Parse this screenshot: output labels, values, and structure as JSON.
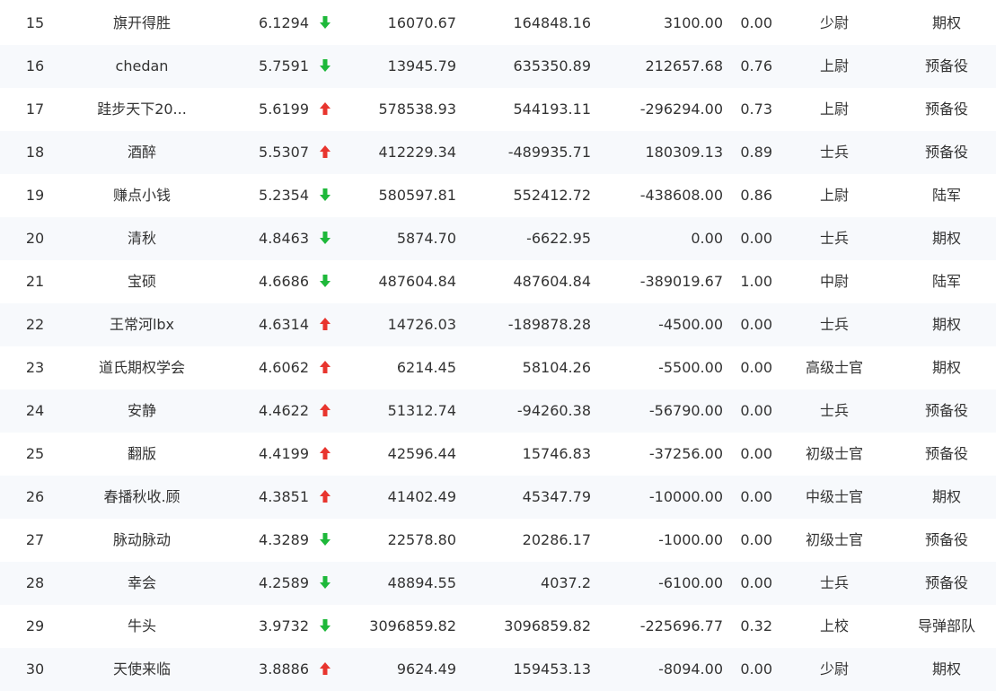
{
  "colors": {
    "up": "#e8352e",
    "down": "#1eb83a",
    "text": "#333333"
  },
  "icons": {
    "up": "arrow-up-icon",
    "down": "arrow-down-icon"
  },
  "rows": [
    {
      "rank": "15",
      "name": "旗开得胜",
      "score": "6.1294",
      "trend": "down",
      "v1": "16070.67",
      "v2": "164848.16",
      "v3": "3100.00",
      "ratio": "0.00",
      "level": "少尉",
      "group": "期权"
    },
    {
      "rank": "16",
      "name": "chedan",
      "score": "5.7591",
      "trend": "down",
      "v1": "13945.79",
      "v2": "635350.89",
      "v3": "212657.68",
      "ratio": "0.76",
      "level": "上尉",
      "group": "预备役"
    },
    {
      "rank": "17",
      "name": "跬步天下20...",
      "score": "5.6199",
      "trend": "up",
      "v1": "578538.93",
      "v2": "544193.11",
      "v3": "-296294.00",
      "ratio": "0.73",
      "level": "上尉",
      "group": "预备役"
    },
    {
      "rank": "18",
      "name": "酒醉",
      "score": "5.5307",
      "trend": "up",
      "v1": "412229.34",
      "v2": "-489935.71",
      "v3": "180309.13",
      "ratio": "0.89",
      "level": "士兵",
      "group": "预备役"
    },
    {
      "rank": "19",
      "name": "赚点小钱",
      "score": "5.2354",
      "trend": "down",
      "v1": "580597.81",
      "v2": "552412.72",
      "v3": "-438608.00",
      "ratio": "0.86",
      "level": "上尉",
      "group": "陆军"
    },
    {
      "rank": "20",
      "name": "清秋",
      "score": "4.8463",
      "trend": "down",
      "v1": "5874.70",
      "v2": "-6622.95",
      "v3": "0.00",
      "ratio": "0.00",
      "level": "士兵",
      "group": "期权"
    },
    {
      "rank": "21",
      "name": "宝硕",
      "score": "4.6686",
      "trend": "down",
      "v1": "487604.84",
      "v2": "487604.84",
      "v3": "-389019.67",
      "ratio": "1.00",
      "level": "中尉",
      "group": "陆军"
    },
    {
      "rank": "22",
      "name": "王常河lbx",
      "score": "4.6314",
      "trend": "up",
      "v1": "14726.03",
      "v2": "-189878.28",
      "v3": "-4500.00",
      "ratio": "0.00",
      "level": "士兵",
      "group": "期权"
    },
    {
      "rank": "23",
      "name": "道氏期权学会",
      "score": "4.6062",
      "trend": "up",
      "v1": "6214.45",
      "v2": "58104.26",
      "v3": "-5500.00",
      "ratio": "0.00",
      "level": "高级士官",
      "group": "期权"
    },
    {
      "rank": "24",
      "name": "安静",
      "score": "4.4622",
      "trend": "up",
      "v1": "51312.74",
      "v2": "-94260.38",
      "v3": "-56790.00",
      "ratio": "0.00",
      "level": "士兵",
      "group": "预备役"
    },
    {
      "rank": "25",
      "name": "翻版",
      "score": "4.4199",
      "trend": "up",
      "v1": "42596.44",
      "v2": "15746.83",
      "v3": "-37256.00",
      "ratio": "0.00",
      "level": "初级士官",
      "group": "预备役"
    },
    {
      "rank": "26",
      "name": "春播秋收.顾",
      "score": "4.3851",
      "trend": "up",
      "v1": "41402.49",
      "v2": "45347.79",
      "v3": "-10000.00",
      "ratio": "0.00",
      "level": "中级士官",
      "group": "期权"
    },
    {
      "rank": "27",
      "name": "脉动脉动",
      "score": "4.3289",
      "trend": "down",
      "v1": "22578.80",
      "v2": "20286.17",
      "v3": "-1000.00",
      "ratio": "0.00",
      "level": "初级士官",
      "group": "预备役"
    },
    {
      "rank": "28",
      "name": "幸会",
      "score": "4.2589",
      "trend": "down",
      "v1": "48894.55",
      "v2": "4037.2",
      "v3": "-6100.00",
      "ratio": "0.00",
      "level": "士兵",
      "group": "预备役"
    },
    {
      "rank": "29",
      "name": "牛头",
      "score": "3.9732",
      "trend": "down",
      "v1": "3096859.82",
      "v2": "3096859.82",
      "v3": "-225696.77",
      "ratio": "0.32",
      "level": "上校",
      "group": "导弹部队"
    },
    {
      "rank": "30",
      "name": "天使来临",
      "score": "3.8886",
      "trend": "up",
      "v1": "9624.49",
      "v2": "159453.13",
      "v3": "-8094.00",
      "ratio": "0.00",
      "level": "少尉",
      "group": "期权"
    }
  ]
}
